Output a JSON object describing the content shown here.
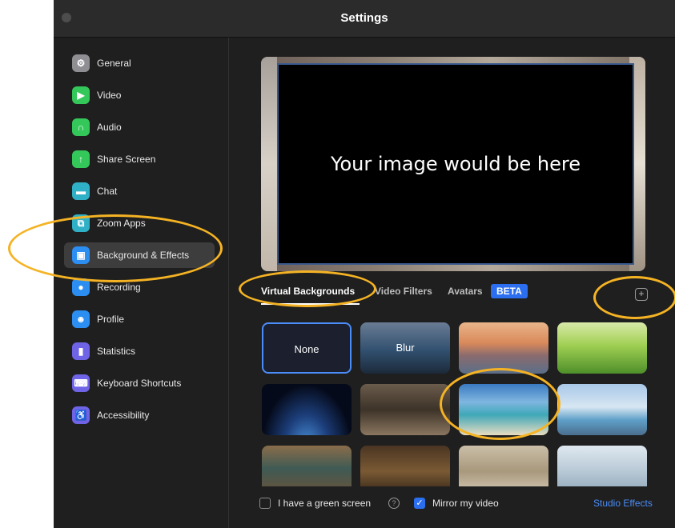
{
  "window": {
    "title": "Settings"
  },
  "sidebar": {
    "items": [
      {
        "label": "General",
        "icon": "gear-icon",
        "color": "#8e8e93",
        "glyph": "⚙"
      },
      {
        "label": "Video",
        "icon": "video-camera-icon",
        "color": "#34c759",
        "glyph": "▶"
      },
      {
        "label": "Audio",
        "icon": "headphones-icon",
        "color": "#34c759",
        "glyph": "∩"
      },
      {
        "label": "Share Screen",
        "icon": "share-screen-icon",
        "color": "#34c759",
        "glyph": "↑"
      },
      {
        "label": "Chat",
        "icon": "chat-bubble-icon",
        "color": "#30b0c7",
        "glyph": "▬"
      },
      {
        "label": "Zoom Apps",
        "icon": "zoom-apps-icon",
        "color": "#30b0c7",
        "glyph": "⧉"
      },
      {
        "label": "Background & Effects",
        "icon": "background-icon",
        "color": "#2b8ef0",
        "glyph": "▣",
        "selected": true
      },
      {
        "label": "Recording",
        "icon": "record-icon",
        "color": "#2b8ef0",
        "glyph": "●"
      },
      {
        "label": "Profile",
        "icon": "profile-icon",
        "color": "#2b8ef0",
        "glyph": "☻"
      },
      {
        "label": "Statistics",
        "icon": "statistics-icon",
        "color": "#6f63e6",
        "glyph": "▮"
      },
      {
        "label": "Keyboard Shortcuts",
        "icon": "keyboard-icon",
        "color": "#6f63e6",
        "glyph": "⌨"
      },
      {
        "label": "Accessibility",
        "icon": "accessibility-icon",
        "color": "#6f63e6",
        "glyph": "♿"
      }
    ]
  },
  "preview": {
    "overlay_text": "Your image would be here"
  },
  "tabs": {
    "virtual_backgrounds": "Virtual Backgrounds",
    "video_filters": "Video Filters",
    "avatars": "Avatars",
    "beta": "BETA"
  },
  "add_button": {
    "glyph": "+",
    "icon": "add-icon"
  },
  "backgrounds": [
    {
      "name": "None",
      "label": "None",
      "style": "none"
    },
    {
      "name": "Blur",
      "label": "Blur",
      "style": "blur"
    },
    {
      "name": "golden-gate-bridge",
      "label": "",
      "style": "bridge"
    },
    {
      "name": "grass",
      "label": "",
      "style": "grass"
    },
    {
      "name": "earth-from-space",
      "label": "",
      "style": "earth"
    },
    {
      "name": "library-hall",
      "label": "",
      "style": "hall"
    },
    {
      "name": "beach-palms",
      "label": "",
      "style": "beach"
    },
    {
      "name": "pier",
      "label": "",
      "style": "pier"
    },
    {
      "name": "bookshop",
      "label": "",
      "style": "shop"
    },
    {
      "name": "pub",
      "label": "",
      "style": "pub"
    },
    {
      "name": "arches",
      "label": "",
      "style": "arches"
    },
    {
      "name": "glass-building",
      "label": "",
      "style": "glass"
    }
  ],
  "footer": {
    "green_screen_label": "I have a green screen",
    "green_screen_checked": false,
    "help_glyph": "?",
    "mirror_label": "Mirror my video",
    "mirror_checked": true,
    "check_glyph": "✓",
    "studio_effects": "Studio Effects"
  },
  "colors": {
    "accent": "#2b6ff0",
    "highlight_ring": "#f5b324",
    "link": "#4a8df8"
  }
}
